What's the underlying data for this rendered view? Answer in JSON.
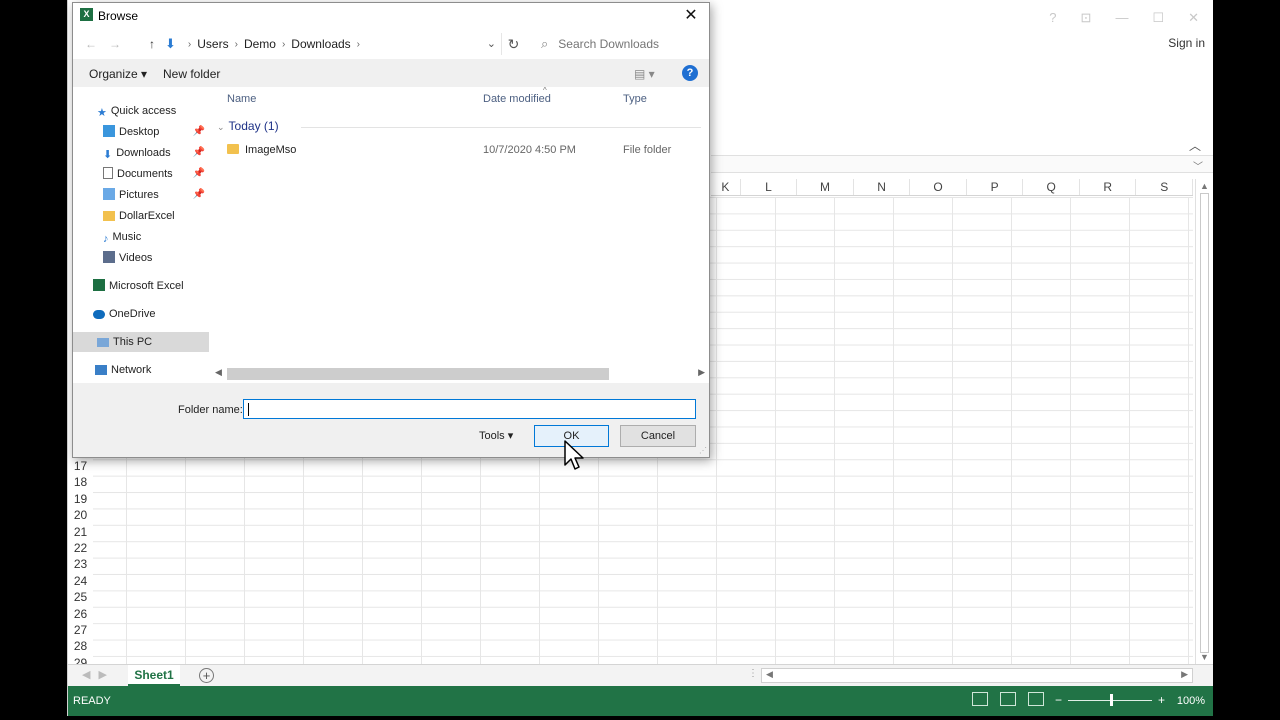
{
  "excel": {
    "title_buttons": [
      "?",
      "⊡",
      "—",
      "☐",
      "✕"
    ],
    "sign_in": "Sign in",
    "columns": [
      "K",
      "L",
      "M",
      "N",
      "O",
      "P",
      "Q",
      "R",
      "S"
    ],
    "rows": [
      "17",
      "18",
      "19",
      "20",
      "21",
      "22",
      "23",
      "24",
      "25",
      "26",
      "27",
      "28",
      "29"
    ],
    "sheet_tab": "Sheet1",
    "status": "READY",
    "zoom": "100%",
    "accent": "#217346"
  },
  "dialog": {
    "title": "Browse",
    "close": "✕",
    "path": [
      "Users",
      "Demo",
      "Downloads"
    ],
    "search_placeholder": "Search Downloads",
    "toolbar": {
      "organize": "Organize ▾",
      "new_folder": "New folder",
      "help": "?"
    },
    "nav": [
      {
        "label": "Quick access",
        "icon": "star-icon",
        "pinned": false
      },
      {
        "label": "Desktop",
        "icon": "desktop-icon",
        "pinned": true
      },
      {
        "label": "Downloads",
        "icon": "download-icon",
        "pinned": true
      },
      {
        "label": "Documents",
        "icon": "documents-icon",
        "pinned": true
      },
      {
        "label": "Pictures",
        "icon": "pictures-icon",
        "pinned": true
      },
      {
        "label": "DollarExcel",
        "icon": "folder-icon",
        "pinned": false
      },
      {
        "label": "Music",
        "icon": "music-icon",
        "pinned": false
      },
      {
        "label": "Videos",
        "icon": "videos-icon",
        "pinned": false
      },
      {
        "label": "Microsoft Excel",
        "icon": "excel-icon",
        "pinned": false
      },
      {
        "label": "OneDrive",
        "icon": "onedrive-icon",
        "pinned": false
      },
      {
        "label": "This PC",
        "icon": "pc-icon",
        "pinned": false,
        "selected": true
      },
      {
        "label": "Network",
        "icon": "network-icon",
        "pinned": false
      }
    ],
    "columns": {
      "name": "Name",
      "date": "Date modified",
      "type": "Type"
    },
    "group": "Today (1)",
    "files": [
      {
        "name": "ImageMso",
        "date": "10/7/2020 4:50 PM",
        "type": "File folder"
      }
    ],
    "folder_label": "Folder name:",
    "folder_value": "",
    "tools": "Tools ▾",
    "ok": "OK",
    "cancel": "Cancel"
  }
}
